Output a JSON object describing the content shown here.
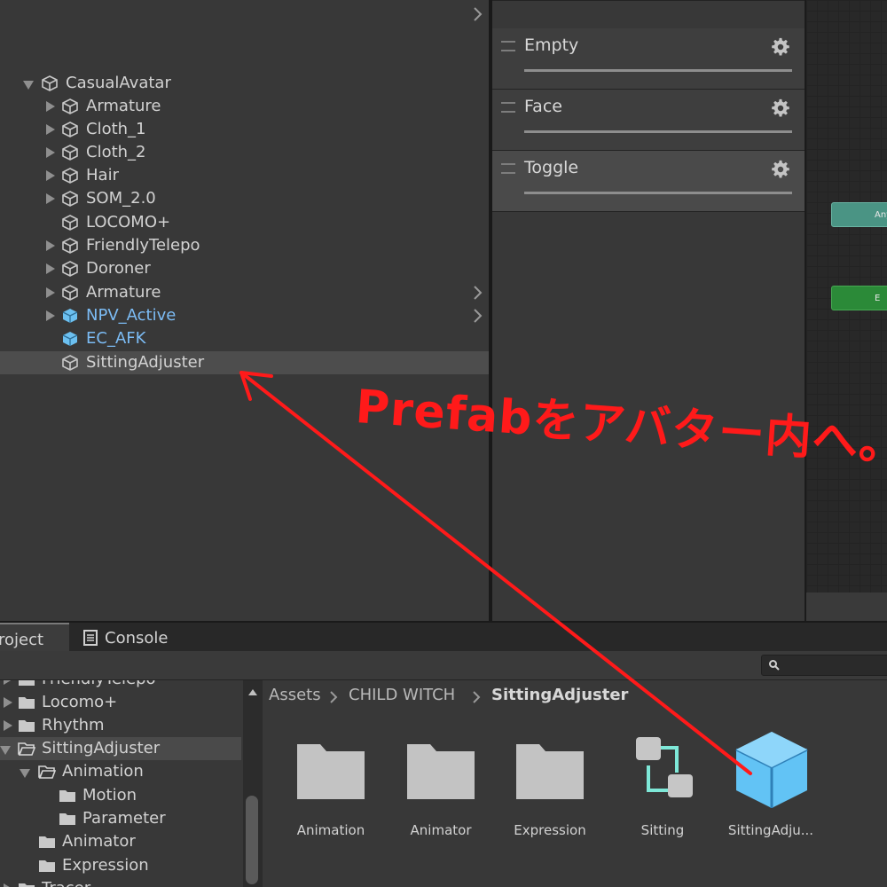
{
  "hierarchy": {
    "items": [
      {
        "label": "CasualAvatar"
      },
      {
        "label": "Armature"
      },
      {
        "label": "Cloth_1"
      },
      {
        "label": "Cloth_2"
      },
      {
        "label": "Hair"
      },
      {
        "label": "SOM_2.0"
      },
      {
        "label": "LOCOMO+"
      },
      {
        "label": "FriendlyTelepo"
      },
      {
        "label": "Doroner"
      },
      {
        "label": "Armature"
      },
      {
        "label": "NPV_Active"
      },
      {
        "label": "EC_AFK"
      },
      {
        "label": "SittingAdjuster"
      }
    ]
  },
  "layers": {
    "items": [
      {
        "name": "Empty"
      },
      {
        "name": "Face"
      },
      {
        "name": "Toggle"
      }
    ]
  },
  "graph": {
    "nodes": [
      {
        "label": "Any",
        "color": "#4a9484"
      },
      {
        "label": "E",
        "color": "#2b8a38"
      }
    ]
  },
  "tabs": {
    "project": "roject",
    "console": "Console"
  },
  "folders": {
    "items": [
      {
        "label": "FriendlyTelepo"
      },
      {
        "label": "Locomo+"
      },
      {
        "label": "Rhythm"
      },
      {
        "label": "SittingAdjuster"
      },
      {
        "label": "Animation"
      },
      {
        "label": "Motion"
      },
      {
        "label": "Parameter"
      },
      {
        "label": "Animator"
      },
      {
        "label": "Expression"
      },
      {
        "label": "Tracer"
      }
    ]
  },
  "breadcrumb": {
    "items": [
      "Assets",
      "CHILD WITCH",
      "SittingAdjuster"
    ]
  },
  "assets": {
    "items": [
      {
        "label": "Animation",
        "icon": "folder-icon"
      },
      {
        "label": "Animator",
        "icon": "folder-icon"
      },
      {
        "label": "Expression",
        "icon": "folder-icon"
      },
      {
        "label": "Sitting",
        "icon": "animator-controller-icon"
      },
      {
        "label": "SittingAdju...",
        "icon": "prefab-icon"
      }
    ]
  },
  "annotation": {
    "text": "Prefabをアバター内へ。",
    "color": "#ff1a1a"
  }
}
